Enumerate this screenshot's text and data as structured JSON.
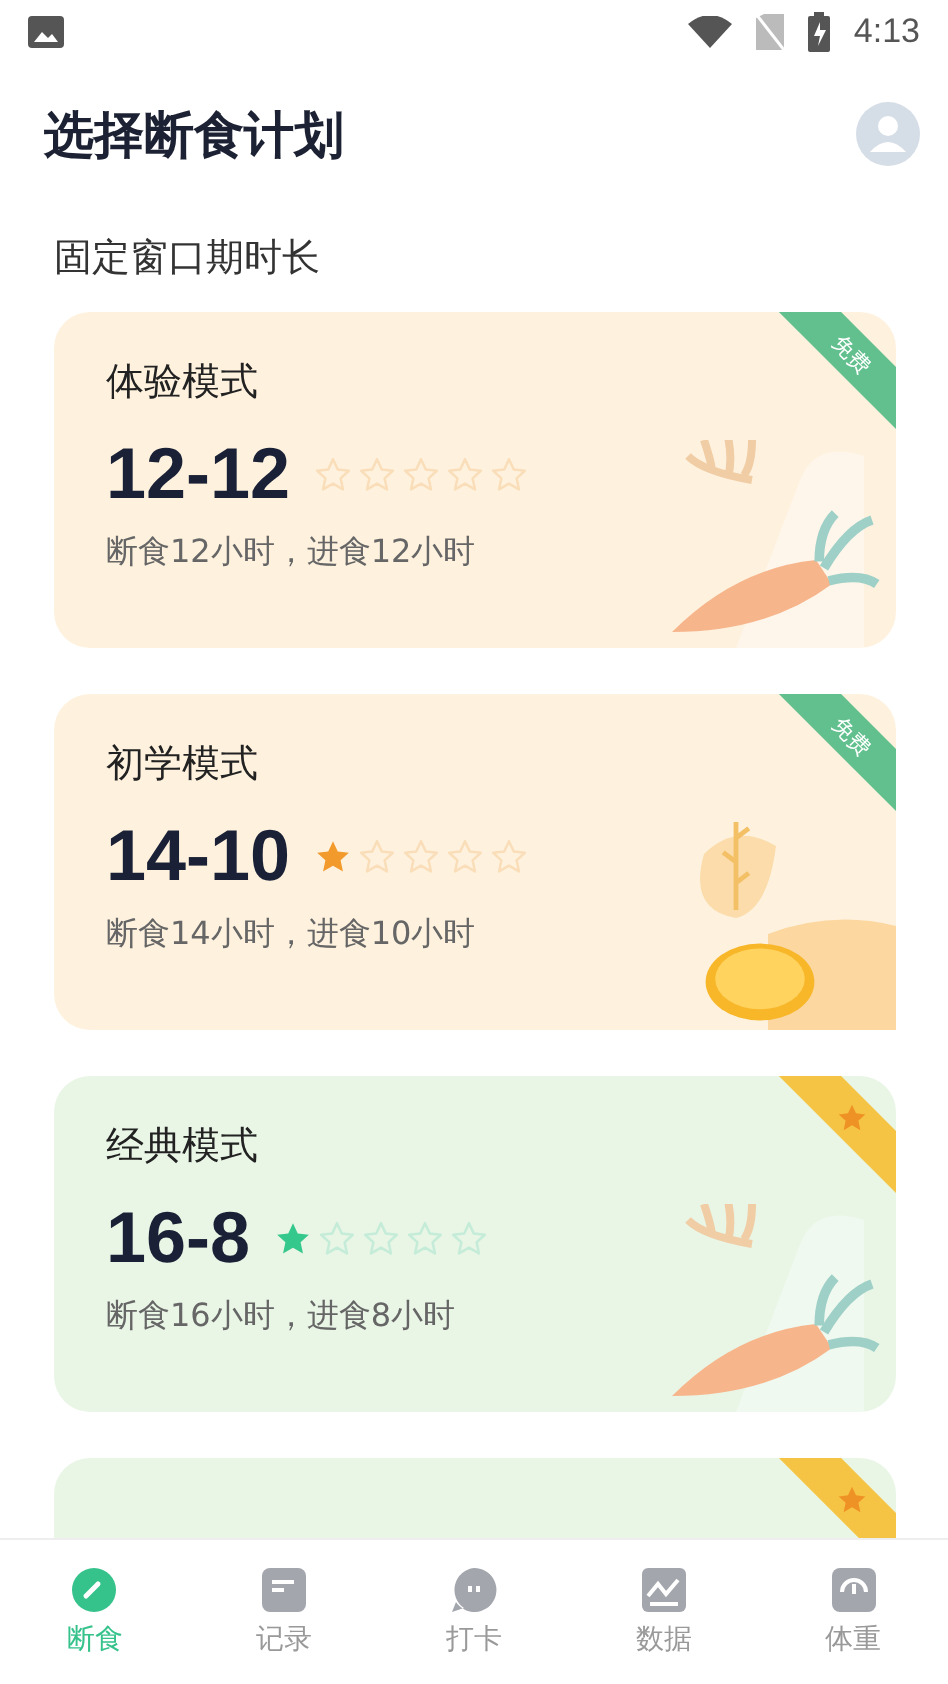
{
  "status_bar": {
    "time": "4:13"
  },
  "header": {
    "title": "选择断食计划"
  },
  "section": {
    "title": "固定窗口期时长"
  },
  "cards": [
    {
      "kind": "free",
      "badge": "免费",
      "title": "体验模式",
      "ratio": "12-12",
      "stars": 0,
      "description": "断食12小时，进食12小时"
    },
    {
      "kind": "free",
      "badge": "免费",
      "title": "初学模式",
      "ratio": "14-10",
      "stars": 1,
      "description": "断食14小时，进食10小时"
    },
    {
      "kind": "premium",
      "title": "经典模式",
      "ratio": "16-8",
      "stars": 1,
      "description": "断食16小时，进食8小时"
    },
    {
      "kind": "premium"
    }
  ],
  "tab_bar": [
    {
      "label": "断食",
      "selected": true
    },
    {
      "label": "记录",
      "selected": false
    },
    {
      "label": "打卡",
      "selected": false
    },
    {
      "label": "数据",
      "selected": false
    },
    {
      "label": "体重",
      "selected": false
    }
  ]
}
